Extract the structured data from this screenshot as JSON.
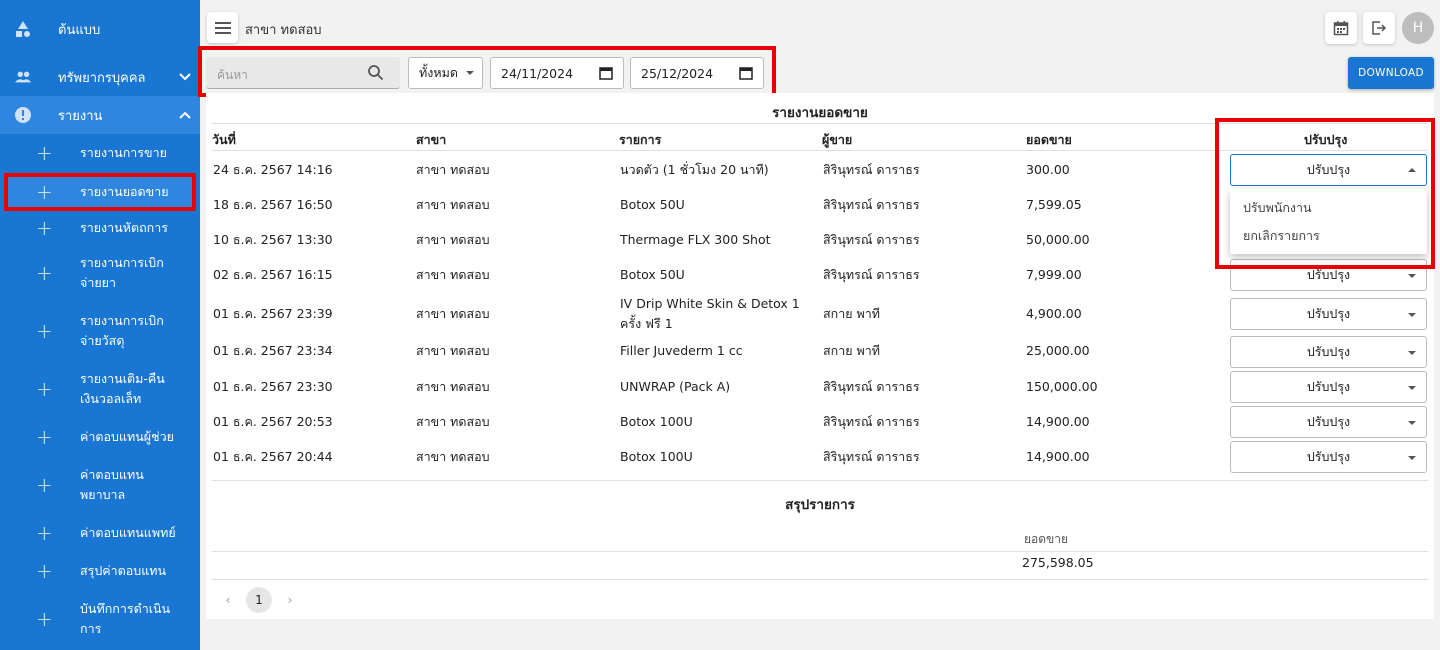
{
  "sidebar": {
    "top_items": [
      {
        "label": "ต้นแบบ",
        "icon": "shapes-icon"
      },
      {
        "label": "ทรัพยากรบุคคล",
        "icon": "people-icon"
      },
      {
        "label": "รายงาน",
        "icon": "alert-circle-icon"
      }
    ],
    "sub_items": [
      {
        "label": "รายงานการขาย"
      },
      {
        "label": "รายงานยอดขาย"
      },
      {
        "label": "รายงานหัตถการ"
      },
      {
        "label": "รายงานการเบิกจ่ายยา"
      },
      {
        "label": "รายงานการเบิกจ่ายวัสดุ"
      },
      {
        "label": "รายงานเติม-คืนเงินวอลเล็ท"
      },
      {
        "label": "ค่าตอบแทนผู้ช่วย"
      },
      {
        "label": "ค่าตอบแทนพยาบาล"
      },
      {
        "label": "ค่าตอบแทนแพทย์"
      },
      {
        "label": "สรุปค่าตอบแทน"
      },
      {
        "label": "บันทึกการดำเนินการ"
      }
    ]
  },
  "header": {
    "branch": "สาขา ทดสอบ",
    "avatar_letter": "H"
  },
  "filters": {
    "search_placeholder": "ค้นหา",
    "status_select": "ทั้งหมด",
    "date_from": "24/11/2024",
    "date_to": "25/12/2024",
    "download_label": "DOWNLOAD"
  },
  "report": {
    "title": "รายงานยอดขาย",
    "columns": [
      "วันที่",
      "สาขา",
      "รายการ",
      "ผู้ขาย",
      "ยอดขาย",
      "ปรับปรุง"
    ],
    "rows": [
      {
        "date": "24 ธ.ค. 2567 14:16",
        "branch": "สาขา ทดสอบ",
        "item": "นวดตัว (1 ชั่วโมง 20 นาที)",
        "seller": "สิรินุทรณ์ ดาราธร",
        "amount": "300.00",
        "adjust": "ปรับปรุง"
      },
      {
        "date": "18 ธ.ค. 2567 16:50",
        "branch": "สาขา ทดสอบ",
        "item": "Botox 50U",
        "seller": "สิรินุทรณ์ ดาราธร",
        "amount": "7,599.05",
        "adjust": "ปรับปรุง"
      },
      {
        "date": "10 ธ.ค. 2567 13:30",
        "branch": "สาขา ทดสอบ",
        "item": "Thermage FLX 300 Shot",
        "seller": "สิรินุทรณ์ ดาราธร",
        "amount": "50,000.00",
        "adjust": "ปรับปรุง"
      },
      {
        "date": "02 ธ.ค. 2567 16:15",
        "branch": "สาขา ทดสอบ",
        "item": "Botox 50U",
        "seller": "สิรินุทรณ์ ดาราธร",
        "amount": "7,999.00",
        "adjust": "ปรับปรุง"
      },
      {
        "date": "01 ธ.ค. 2567 23:39",
        "branch": "สาขา ทดสอบ",
        "item": "IV Drip White Skin & Detox 1 ครั้ง ฟรี 1",
        "seller": "สกาย พาที",
        "amount": "4,900.00",
        "adjust": "ปรับปรุง"
      },
      {
        "date": "01 ธ.ค. 2567 23:34",
        "branch": "สาขา ทดสอบ",
        "item": "Filler Juvederm 1 cc",
        "seller": "สกาย พาที",
        "amount": "25,000.00",
        "adjust": "ปรับปรุง"
      },
      {
        "date": "01 ธ.ค. 2567 23:30",
        "branch": "สาขา ทดสอบ",
        "item": "UNWRAP (Pack A)",
        "seller": "สิรินุทรณ์ ดาราธร",
        "amount": "150,000.00",
        "adjust": "ปรับปรุง"
      },
      {
        "date": "01 ธ.ค. 2567 20:53",
        "branch": "สาขา ทดสอบ",
        "item": "Botox 100U",
        "seller": "สิรินุทรณ์ ดาราธร",
        "amount": "14,900.00",
        "adjust": "ปรับปรุง"
      },
      {
        "date": "01 ธ.ค. 2567 20:44",
        "branch": "สาขา ทดสอบ",
        "item": "Botox 100U",
        "seller": "สิรินุทรณ์ ดาราธร",
        "amount": "14,900.00",
        "adjust": "ปรับปรุง"
      }
    ],
    "dropdown_options": [
      "ปรับพนักงาน",
      "ยกเลิกรายการ"
    ]
  },
  "summary": {
    "title": "สรุปรายการ",
    "label": "ยอดขาย",
    "value": "275,598.05"
  },
  "pagination": {
    "current_page": "1"
  }
}
